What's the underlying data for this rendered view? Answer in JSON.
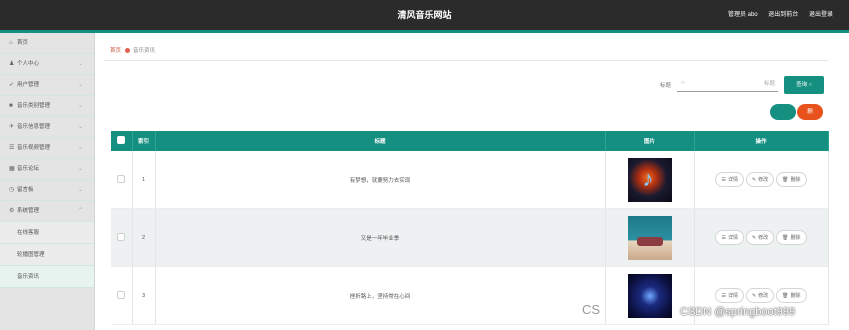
{
  "header": {
    "title": "清风音乐网站",
    "links": [
      "管理员 abo",
      "退出到前台",
      "退出登录"
    ]
  },
  "sidebar": {
    "items": [
      {
        "label": "首页",
        "icon": "home-icon",
        "glyph": "⌂",
        "chevron": ""
      },
      {
        "label": "个人中心",
        "icon": "user-icon",
        "glyph": "♟",
        "chevron": "⌄"
      },
      {
        "label": "用户管理",
        "icon": "send-icon",
        "glyph": "➶",
        "chevron": "⌄"
      },
      {
        "label": "音乐类别管理",
        "icon": "video-icon",
        "glyph": "■",
        "chevron": "⌄"
      },
      {
        "label": "音乐信息管理",
        "icon": "plane-icon",
        "glyph": "✈",
        "chevron": "⌄"
      },
      {
        "label": "音乐视频管理",
        "icon": "sliders-icon",
        "glyph": "☰",
        "chevron": "⌄"
      },
      {
        "label": "音乐论坛",
        "icon": "building-icon",
        "glyph": "▦",
        "chevron": "⌄"
      },
      {
        "label": "留言板",
        "icon": "clock-icon",
        "glyph": "◷",
        "chevron": "⌄"
      },
      {
        "label": "系统管理",
        "icon": "gear-icon",
        "glyph": "⚙",
        "chevron": "⌃"
      }
    ],
    "subitems": [
      {
        "label": "在线客服",
        "active": false
      },
      {
        "label": "轮播图管理",
        "active": false
      },
      {
        "label": "音乐资讯",
        "active": true
      }
    ]
  },
  "breadcrumb": {
    "home": "首页",
    "current": "音乐资讯"
  },
  "search": {
    "label": "标题",
    "placeholder": "标题",
    "button": "查询 ○"
  },
  "actions": {
    "add": "",
    "delete": "删"
  },
  "table": {
    "headers": [
      "",
      "索引",
      "标题",
      "图片",
      "操作"
    ],
    "rows": [
      {
        "index": "1",
        "title": "有梦想，就要努力去实现",
        "thumb": "t1"
      },
      {
        "index": "2",
        "title": "又是一年毕业季",
        "thumb": "t2"
      },
      {
        "index": "3",
        "title": "挫折路上，坚持常在心间",
        "thumb": "t3"
      }
    ],
    "ops": {
      "detail": "详情",
      "edit": "修改",
      "remove": "删除"
    }
  },
  "watermark": {
    "left": "CS",
    "right": "CSDN @springboot999"
  }
}
